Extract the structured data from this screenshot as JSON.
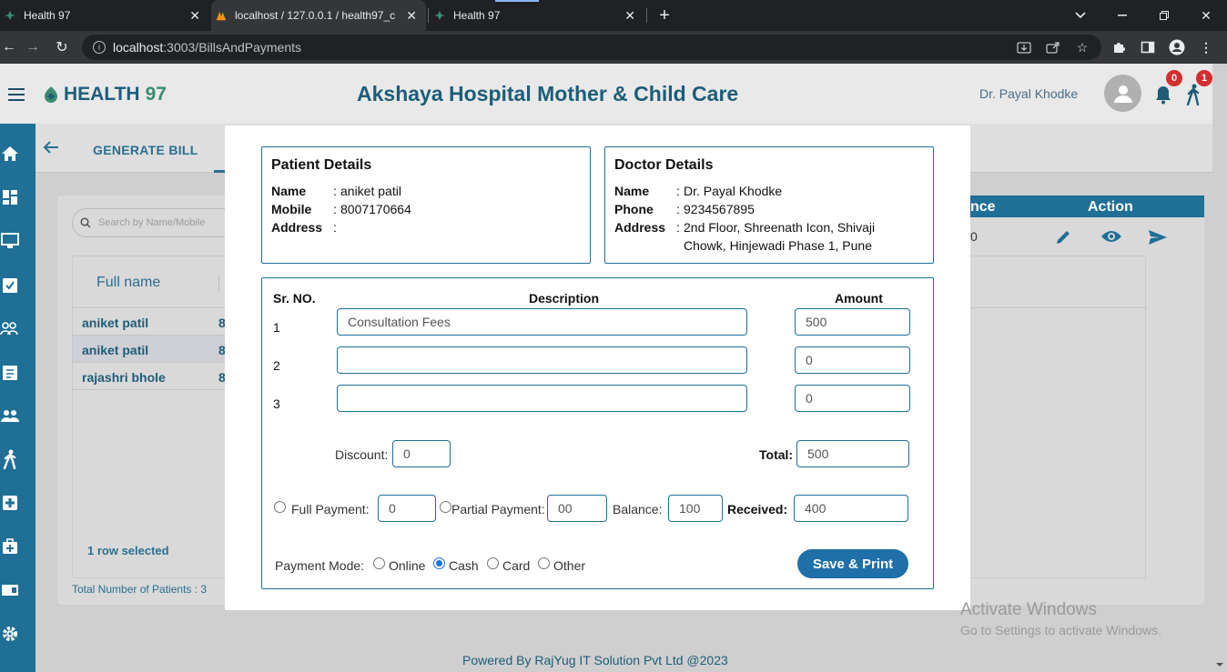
{
  "browser": {
    "tabs": [
      {
        "title": "Health 97"
      },
      {
        "title": "localhost / 127.0.0.1 / health97_c"
      },
      {
        "title": "Health 97"
      }
    ],
    "url_host": "localhost",
    "url_path": ":3003/BillsAndPayments"
  },
  "header": {
    "logo_word": "HEALTH",
    "logo_num": "97",
    "hospital_name": "Akshaya Hospital Mother & Child Care",
    "doctor_name": "Dr. Payal Khodke",
    "notification_count": "0",
    "walkin_count": "1"
  },
  "subbar": {
    "tab_label": "GENERATE BILL"
  },
  "background_list": {
    "search_placeholder": "Search by Name/Mobile",
    "column_full_name": "Full name",
    "column_balance": "nce",
    "column_action": "Action",
    "balance_value": "0",
    "rows": [
      {
        "name": "aniket patil",
        "mobile": "8"
      },
      {
        "name": "aniket patil",
        "mobile": "8"
      },
      {
        "name": "rajashri bhole",
        "mobile": "8"
      }
    ],
    "selected_text": "1 row selected",
    "total_text": "Total Number of Patients : 3"
  },
  "footer": {
    "text": "Powered By RajYug IT Solution Pvt Ltd @2023"
  },
  "watermark": {
    "line1": "Activate Windows",
    "line2": "Go to Settings to activate Windows."
  },
  "patient": {
    "title": "Patient Details",
    "name_label": "Name",
    "name_value": "aniket patil",
    "mobile_label": "Mobile",
    "mobile_value": "8007170664",
    "address_label": "Address",
    "address_value": ""
  },
  "doctor": {
    "title": "Doctor Details",
    "name_label": "Name",
    "name_value": "Dr. Payal Khodke",
    "phone_label": "Phone",
    "phone_value": "9234567895",
    "address_label": "Address",
    "address_line1": "2nd Floor, Shreenath Icon, Shivaji",
    "address_line2": "Chowk, Hinjewadi Phase 1, Pune"
  },
  "bill": {
    "col_sr": "Sr. NO.",
    "col_desc": "Description",
    "col_amount": "Amount",
    "items": [
      {
        "sr": "1",
        "description": "Consultation Fees",
        "amount": "500"
      },
      {
        "sr": "2",
        "description": "",
        "amount": "0"
      },
      {
        "sr": "3",
        "description": "",
        "amount": "0"
      }
    ],
    "discount_label": "Discount:",
    "discount_value": "0",
    "total_label": "Total:",
    "total_value": "500",
    "full_payment_label": "Full Payment:",
    "full_payment_value": "0",
    "partial_payment_label": "Partial Payment:",
    "partial_payment_value": "00",
    "balance_label": "Balance:",
    "balance_value": "100",
    "received_label": "Received:",
    "received_value": "400",
    "payment_mode_label": "Payment Mode:",
    "modes": [
      "Online",
      "Cash",
      "Card",
      "Other"
    ],
    "selected_mode": "Cash",
    "save_label": "Save & Print"
  }
}
